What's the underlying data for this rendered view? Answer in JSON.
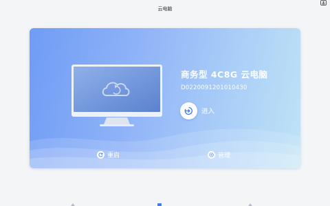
{
  "window": {
    "title": "云电脑"
  },
  "device": {
    "name": "商务型 4C8G 云电脑",
    "serial": "D0220091201010430"
  },
  "actions": {
    "enter_label": "进入",
    "restart_label": "重启",
    "manage_label": "管理"
  },
  "icons": {
    "user": "user-icon",
    "cloud": "cloud-sync-icon",
    "enter": "enter-icon",
    "restart": "restart-icon",
    "manage": "gear-icon"
  },
  "colors": {
    "accent": "#3d7bf0",
    "card_start": "#6f9cf5",
    "card_end": "#bfe3f6"
  }
}
